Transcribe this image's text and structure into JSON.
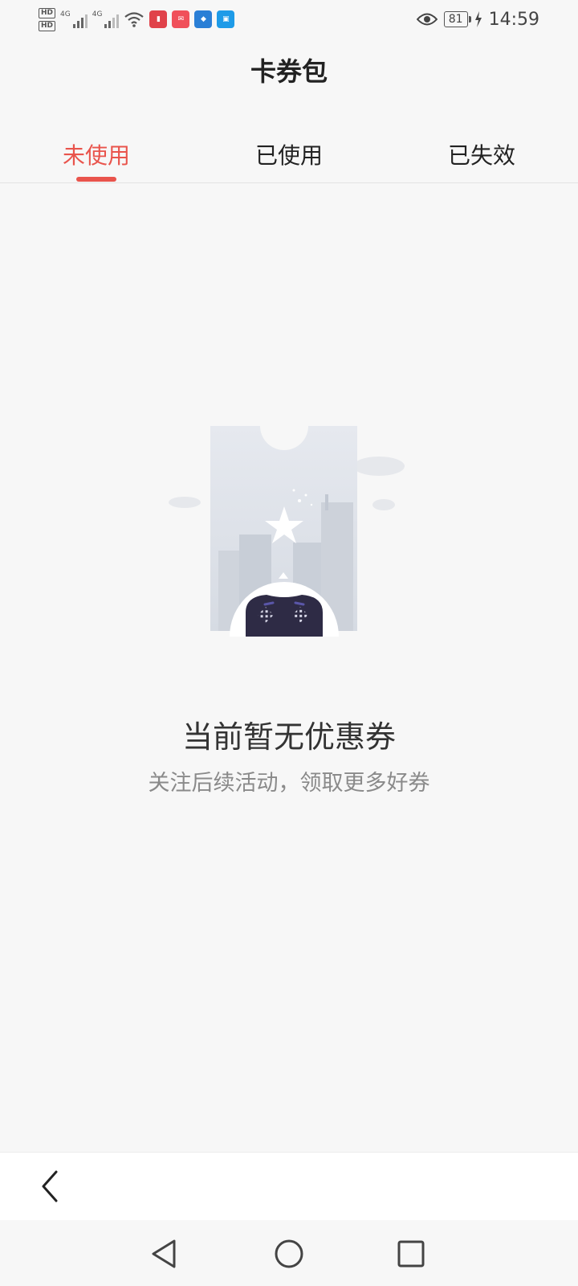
{
  "status_bar": {
    "hd1": "HD",
    "hd2": "HD",
    "net1": "4G",
    "net2": "4G",
    "battery": "81",
    "time": "14:59"
  },
  "page": {
    "title": "卡券包"
  },
  "tabs": [
    {
      "label": "未使用",
      "active": true
    },
    {
      "label": "已使用",
      "active": false
    },
    {
      "label": "已失效",
      "active": false
    }
  ],
  "empty_state": {
    "title": "当前暂无优惠券",
    "subtitle": "关注后续活动，领取更多好券"
  },
  "colors": {
    "accent": "#e9544c",
    "background": "#f7f7f7"
  },
  "icons": {
    "back": "chevron-left-icon",
    "nav_back": "triangle-back-icon",
    "nav_home": "circle-home-icon",
    "nav_recent": "square-recent-icon"
  }
}
